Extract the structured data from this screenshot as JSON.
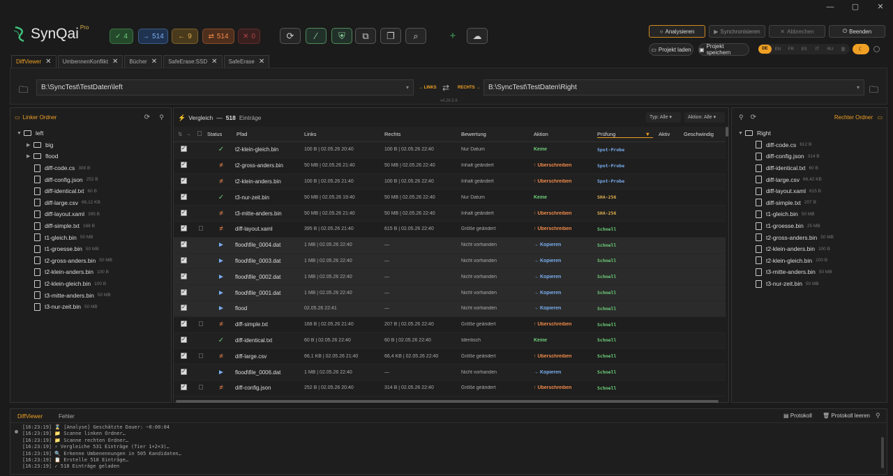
{
  "window": {
    "minimize": "—",
    "maximize": "▢",
    "close": "✕"
  },
  "app": {
    "name": "SynQai",
    "badge": "Pro",
    "version": "v4.26.5.6"
  },
  "stats": [
    {
      "icon": "✓",
      "value": "4",
      "color": "#6fd07a",
      "bg": "#244a2b"
    },
    {
      "icon": "→",
      "value": "514",
      "color": "#7aaef0",
      "bg": "#1f3350"
    },
    {
      "icon": "←",
      "value": "9",
      "color": "#e0b050",
      "bg": "#4a3a1c"
    },
    {
      "icon": "⇄",
      "value": "514",
      "color": "#f08a4a",
      "bg": "#4e2e1c"
    },
    {
      "icon": "✕",
      "value": "0",
      "color": "#b04848",
      "bg": "#3a1f1f"
    }
  ],
  "actions": {
    "analyze": "Analysieren",
    "sync": "Synchronisieren",
    "cancel": "Abbrechen",
    "quit": "Beenden",
    "load": "Projekt laden",
    "save": "Projekt speichern"
  },
  "languages": [
    "DE",
    "EN",
    "FR",
    "ES",
    "IT",
    "RU",
    "歌"
  ],
  "tabs": [
    "DiffViewer",
    "UmbennenKonflikt",
    "Bücher",
    "SafeErase:SSD",
    "SafeErase"
  ],
  "paths": {
    "left": "B:\\SyncTest\\TestDaten\\left",
    "right": "B:\\SyncTest\\TestDaten\\Right",
    "left_tag": "→ LINKS",
    "right_tag": "RECHTS →"
  },
  "left_panel": {
    "title": "Linker Ordner",
    "root": "left",
    "items": [
      {
        "type": "dir",
        "name": "big",
        "size": ""
      },
      {
        "type": "dir",
        "name": "flood",
        "size": ""
      },
      {
        "type": "file",
        "name": "diff-code.cs",
        "size": "308 B"
      },
      {
        "type": "file",
        "name": "diff-config.json",
        "size": "252 B"
      },
      {
        "type": "file",
        "name": "diff-identical.txt",
        "size": "60 B"
      },
      {
        "type": "file",
        "name": "diff-large.csv",
        "size": "66,12 KB"
      },
      {
        "type": "file",
        "name": "diff-layout.xaml",
        "size": "395 B"
      },
      {
        "type": "file",
        "name": "diff-simple.txt",
        "size": "168 B"
      },
      {
        "type": "file",
        "name": "t1-gleich.bin",
        "size": "50 MB"
      },
      {
        "type": "file",
        "name": "t1-groesse.bin",
        "size": "50 MB"
      },
      {
        "type": "file",
        "name": "t2-gross-anders.bin",
        "size": "50 MB"
      },
      {
        "type": "file",
        "name": "t2-klein-anders.bin",
        "size": "100 B"
      },
      {
        "type": "file",
        "name": "t2-klein-gleich.bin",
        "size": "100 B"
      },
      {
        "type": "file",
        "name": "t3-mitte-anders.bin",
        "size": "50 MB"
      },
      {
        "type": "file",
        "name": "t3-nur-zeit.bin",
        "size": "50 MB"
      }
    ]
  },
  "right_panel": {
    "title": "Rechter Ordner",
    "root": "Right",
    "items": [
      {
        "name": "diff-code.cs",
        "size": "612 B"
      },
      {
        "name": "diff-config.json",
        "size": "314 B"
      },
      {
        "name": "diff-identical.txt",
        "size": "60 B"
      },
      {
        "name": "diff-large.csv",
        "size": "66,42 KB"
      },
      {
        "name": "diff-layout.xaml",
        "size": "615 B"
      },
      {
        "name": "diff-simple.txt",
        "size": "207 B"
      },
      {
        "name": "t1-gleich.bin",
        "size": "50 MB"
      },
      {
        "name": "t1-groesse.bin",
        "size": "25 MB"
      },
      {
        "name": "t2-gross-anders.bin",
        "size": "50 MB"
      },
      {
        "name": "t2-klein-anders.bin",
        "size": "100 B"
      },
      {
        "name": "t2-klein-gleich.bin",
        "size": "100 B"
      },
      {
        "name": "t3-mitte-anders.bin",
        "size": "50 MB"
      },
      {
        "name": "t3-nur-zeit.bin",
        "size": "50 MB"
      }
    ]
  },
  "compare": {
    "title": "Vergleich",
    "dash": "—",
    "count": "518",
    "count_label": "Einträge",
    "filter_type": "Typ: Alle",
    "filter_action": "Aktion: Alle",
    "columns": [
      "Status",
      "Pfad",
      "Links",
      "Rechts",
      "Bewertung",
      "Aktion",
      "Prüfung",
      "Aktiv",
      "Geschwindig"
    ],
    "rows": [
      {
        "status": "✓",
        "sc": "#6fd07a",
        "box": false,
        "path": "t2-klein-gleich.bin",
        "left": "100 B | 02.05.26 20:40",
        "right": "100 B | 02.05.26 22:40",
        "rating": "Nur Datum",
        "action": "Keine",
        "ac": "#6fd07a",
        "check": "Spot-Probe",
        "cc": "#7aaef0"
      },
      {
        "status": "≠",
        "sc": "#f08a4a",
        "box": false,
        "path": "t2-gross-anders.bin",
        "left": "50 MB | 02.05.26 21:40",
        "right": "50 MB | 02.05.26 22:40",
        "rating": "Inhalt geändert",
        "action": "↑ Überschreiben",
        "ac": "#f08a4a",
        "check": "Spot-Probe",
        "cc": "#7aaef0"
      },
      {
        "status": "≠",
        "sc": "#f08a4a",
        "box": false,
        "path": "t2-klein-anders.bin",
        "left": "100 B | 02.05.26 21:40",
        "right": "100 B | 02.05.26 22:40",
        "rating": "Inhalt geändert",
        "action": "↑ Überschreiben",
        "ac": "#f08a4a",
        "check": "Spot-Probe",
        "cc": "#7aaef0"
      },
      {
        "status": "✓",
        "sc": "#6fd07a",
        "box": false,
        "path": "t3-nur-zeit.bin",
        "left": "50 MB | 02.05.26 19:40",
        "right": "50 MB | 02.05.26 22:40",
        "rating": "Nur Datum",
        "action": "Keine",
        "ac": "#6fd07a",
        "check": "SHA-256",
        "cc": "#e0b050"
      },
      {
        "status": "≠",
        "sc": "#f08a4a",
        "box": false,
        "path": "t3-mitte-anders.bin",
        "left": "50 MB | 02.05.26 21:40",
        "right": "50 MB | 02.05.26 22:40",
        "rating": "Inhalt geändert",
        "action": "↑ Überschreiben",
        "ac": "#f08a4a",
        "check": "SHA-256",
        "cc": "#e0b050"
      },
      {
        "status": "≠",
        "sc": "#f08a4a",
        "box": true,
        "path": "diff-layout.xaml",
        "left": "395 B | 02.05.26 21:40",
        "right": "615 B | 02.05.26 22:40",
        "rating": "Größe geändert",
        "action": "↑ Überschreiben",
        "ac": "#f08a4a",
        "check": "Schnell",
        "cc": "#6fd07a"
      },
      {
        "status": "►",
        "sc": "#7aaef0",
        "box": false,
        "path": "flood\\file_0004.dat",
        "left": "1 MB | 02.05.26 22:40",
        "right": "—",
        "rating": "Nicht vorhanden",
        "action": "→ Kopieren",
        "ac": "#7aaef0",
        "check": "Schnell",
        "cc": "#6fd07a"
      },
      {
        "status": "►",
        "sc": "#7aaef0",
        "box": false,
        "path": "flood\\file_0003.dat",
        "left": "1 MB | 02.05.26 22:40",
        "right": "—",
        "rating": "Nicht vorhanden",
        "action": "→ Kopieren",
        "ac": "#7aaef0",
        "check": "Schnell",
        "cc": "#6fd07a"
      },
      {
        "status": "►",
        "sc": "#7aaef0",
        "box": false,
        "path": "flood\\file_0002.dat",
        "left": "1 MB | 02.05.26 22:40",
        "right": "—",
        "rating": "Nicht vorhanden",
        "action": "→ Kopieren",
        "ac": "#7aaef0",
        "check": "Schnell",
        "cc": "#6fd07a"
      },
      {
        "status": "►",
        "sc": "#7aaef0",
        "box": false,
        "path": "flood\\file_0001.dat",
        "left": "1 MB | 02.05.26 22:40",
        "right": "—",
        "rating": "Nicht vorhanden",
        "action": "→ Kopieren",
        "ac": "#7aaef0",
        "check": "Schnell",
        "cc": "#6fd07a"
      },
      {
        "status": "►",
        "sc": "#7aaef0",
        "box": false,
        "path": "flood",
        "left": "02.05.26 22:41",
        "right": "—",
        "rating": "Nicht vorhanden",
        "action": "→ Kopieren",
        "ac": "#7aaef0",
        "check": "Schnell",
        "cc": "#6fd07a"
      },
      {
        "status": "≠",
        "sc": "#f08a4a",
        "box": true,
        "path": "diff-simple.txt",
        "left": "168 B | 02.05.26 21:40",
        "right": "207 B | 02.05.26 22:40",
        "rating": "Größe geändert",
        "action": "↑ Überschreiben",
        "ac": "#f08a4a",
        "check": "Schnell",
        "cc": "#6fd07a"
      },
      {
        "status": "✓",
        "sc": "#6fd07a",
        "box": false,
        "path": "diff-identical.txt",
        "left": "60 B | 02.05.26 22:40",
        "right": "60 B | 02.05.26 22:40",
        "rating": "Identisch",
        "action": "Keine",
        "ac": "#6fd07a",
        "check": "Schnell",
        "cc": "#6fd07a"
      },
      {
        "status": "≠",
        "sc": "#f08a4a",
        "box": true,
        "path": "diff-large.csv",
        "left": "66,1 KB | 02.05.26 21:40",
        "right": "66,4 KB | 02.05.26 22:40",
        "rating": "Größe geändert",
        "action": "↑ Überschreiben",
        "ac": "#f08a4a",
        "check": "Schnell",
        "cc": "#6fd07a"
      },
      {
        "status": "►",
        "sc": "#7aaef0",
        "box": false,
        "path": "flood\\file_0006.dat",
        "left": "1 MB | 02.05.26 22:40",
        "right": "—",
        "rating": "Nicht vorhanden",
        "action": "→ Kopieren",
        "ac": "#7aaef0",
        "check": "Schnell",
        "cc": "#6fd07a"
      },
      {
        "status": "≠",
        "sc": "#f08a4a",
        "box": true,
        "path": "diff-config.json",
        "left": "252 B | 02.05.26 20:40",
        "right": "314 B | 02.05.26 22:40",
        "rating": "Größe geändert",
        "action": "↑ Überschreiben",
        "ac": "#f08a4a",
        "check": "Schnell",
        "cc": "#6fd07a"
      }
    ]
  },
  "log": {
    "tab_active": "DiffViewer",
    "tab_other": "Fehler",
    "protocol": "Protokoll",
    "clear": "Protokoll leeren",
    "lines": [
      "[16:23:19] ⌛ [Analyse] Geschätzte Dauer: ~0:00:04",
      "[16:23:19] 📁 Scanne linken Ordner…",
      "[16:23:19] 📁 Scanne rechten Ordner…",
      "[16:23:19] ⚡ Vergleiche 531 Einträge (Tier 1+2+3)…",
      "[16:23:19] 🔍 Erkenne Umbenennungen in 505 Kandidaten…",
      "[16:23:19] 📋 Erstelle 518 Einträge…",
      "[16:23:19] ✓ 518 Einträge geladen"
    ]
  }
}
